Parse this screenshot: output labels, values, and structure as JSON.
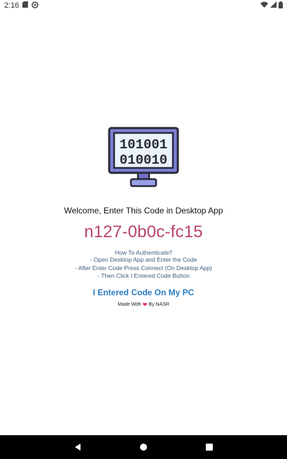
{
  "status_bar": {
    "time": "2:16",
    "icons": [
      "sd-card-icon",
      "sync-icon",
      "wifi-icon",
      "signal-icon",
      "battery-icon"
    ]
  },
  "monitor": {
    "line1": "101001",
    "line2": "010010"
  },
  "welcome": "Welcome, Enter This Code in Desktop App",
  "code": "n127-0b0c-fc15",
  "instructions": {
    "title": "How To Authenticate?",
    "steps": [
      "- Open Desktop App and Enter the Code",
      "- After Enter Code Press Connect (On Desktop App)",
      "- Then Click I Entered Code Button"
    ]
  },
  "confirm_button": "I Entered Code On My PC",
  "credit": {
    "prefix": "Made With",
    "suffix": "By NASR"
  },
  "nav": [
    "back-icon",
    "home-icon",
    "recents-icon"
  ],
  "colors": {
    "code": "#b9436a",
    "button": "#2b7bc0",
    "instructions": "#3c5d7c",
    "heart": "#e0245e"
  }
}
